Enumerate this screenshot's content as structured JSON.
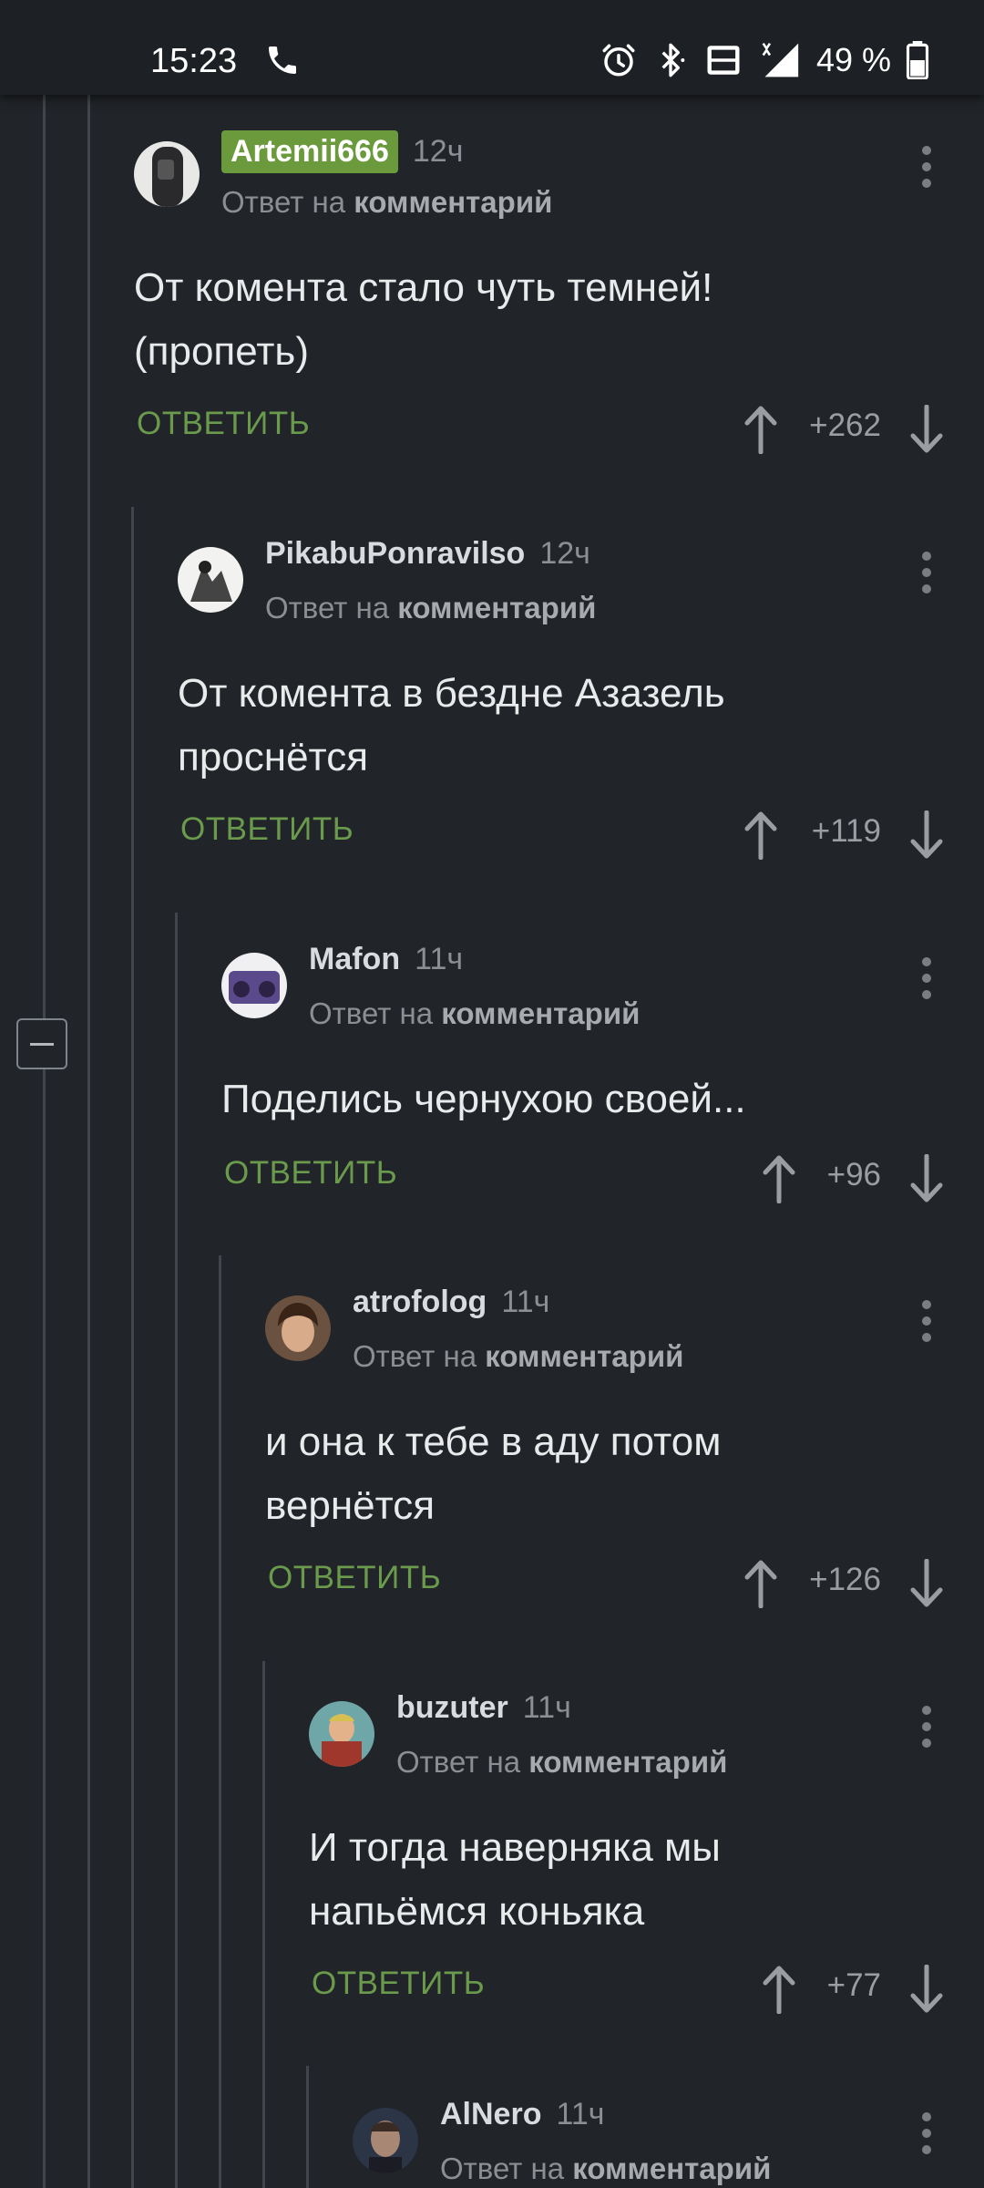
{
  "status_bar": {
    "time": "15:23",
    "battery_percent": "49 %",
    "icons": [
      "phone-icon",
      "alarm-icon",
      "bluetooth-icon",
      "volte-icon",
      "signal-4g-icon",
      "battery-icon"
    ]
  },
  "colors": {
    "background": "#212428",
    "badge_green": "#6a9a3c",
    "reply_green": "#6a9a4c",
    "muted_text": "#8b8f94"
  },
  "comments": [
    {
      "author": "Artemii666",
      "time": "12ч",
      "reply_prefix": "Ответ на",
      "reply_target": "комментарий",
      "line1": "От комента стало чуть темней!",
      "line2": "(пропеть)",
      "reply_label": "ОТВЕТИТЬ",
      "score": "+262"
    },
    {
      "author": "PikabuPonravilso",
      "time": "12ч",
      "reply_prefix": "Ответ на",
      "reply_target": "комментарий",
      "line1": "От комента в бездне Азазель",
      "line2": "проснётся",
      "reply_label": "ОТВЕТИТЬ",
      "score": "+119"
    },
    {
      "author": "Mafon",
      "time": "11ч",
      "reply_prefix": "Ответ на",
      "reply_target": "комментарий",
      "line1": "Поделись чернухою своей...",
      "line2": "",
      "reply_label": "ОТВЕТИТЬ",
      "score": "+96"
    },
    {
      "author": "atrofolog",
      "time": "11ч",
      "reply_prefix": "Ответ на",
      "reply_target": "комментарий",
      "line1": "и она к тебе в аду потом",
      "line2": "вернётся",
      "reply_label": "ОТВЕТИТЬ",
      "score": "+126"
    },
    {
      "author": "buzuter",
      "time": "11ч",
      "reply_prefix": "Ответ на",
      "reply_target": "комментарий",
      "line1": "И тогда наверняка мы",
      "line2": "напьёмся коньяка",
      "reply_label": "ОТВЕТИТЬ",
      "score": "+77"
    },
    {
      "author": "AlNero",
      "time": "11ч",
      "reply_prefix": "Ответ на",
      "reply_target": "комментарий"
    }
  ]
}
